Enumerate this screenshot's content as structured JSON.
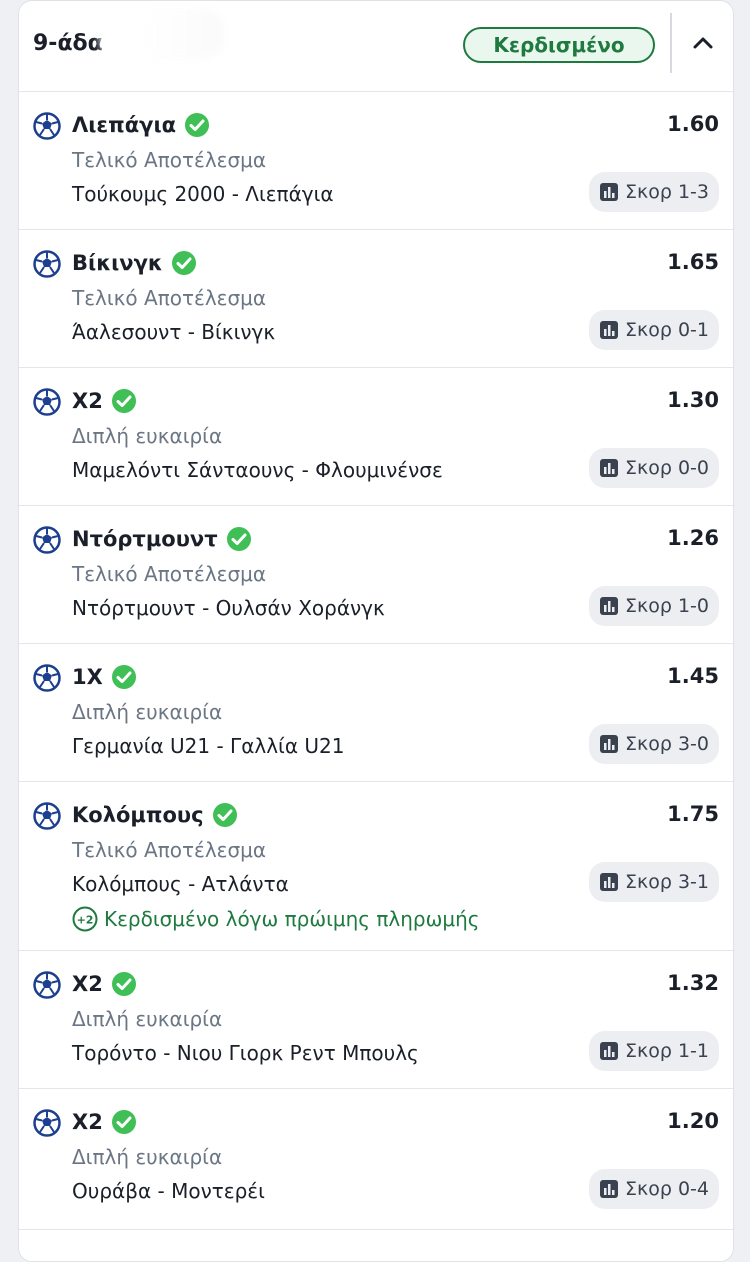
{
  "header": {
    "title": "9-άδα",
    "status": "Κερδισμένο"
  },
  "bets": [
    {
      "selection": "Λιεπάγια",
      "odds": "1.60",
      "market": "Τελικό Αποτέλεσμα",
      "match": "Τούκουμς 2000 - Λιεπάγια",
      "score": "Σκορ 1-3"
    },
    {
      "selection": "Βίκινγκ",
      "odds": "1.65",
      "market": "Τελικό Αποτέλεσμα",
      "match": "Άαλεσουντ - Βίκινγκ",
      "score": "Σκορ 0-1"
    },
    {
      "selection": "Χ2",
      "odds": "1.30",
      "market": "Διπλή ευκαιρία",
      "match": "Μαμελόντι Σάνταουνς - Φλουμινένσε",
      "score": "Σκορ 0-0"
    },
    {
      "selection": "Ντόρτμουντ",
      "odds": "1.26",
      "market": "Τελικό Αποτέλεσμα",
      "match": "Ντόρτμουντ - Ουλσάν Χοράνγκ",
      "score": "Σκορ 1-0"
    },
    {
      "selection": "1Χ",
      "odds": "1.45",
      "market": "Διπλή ευκαιρία",
      "match": "Γερμανία U21 - Γαλλία U21",
      "score": "Σκορ 3-0"
    },
    {
      "selection": "Κολόμπους",
      "odds": "1.75",
      "market": "Τελικό Αποτέλεσμα",
      "match": "Κολόμπους - Ατλάντα",
      "score": "Σκορ 3-1",
      "early_text": "Κερδισμένο λόγω πρώιμης πληρωμής",
      "early_badge": "+2"
    },
    {
      "selection": "Χ2",
      "odds": "1.32",
      "market": "Διπλή ευκαιρία",
      "match": "Τορόντο - Νιου Γιορκ Ρεντ Μπουλς",
      "score": "Σκορ 1-1"
    },
    {
      "selection": "Χ2",
      "odds": "1.20",
      "market": "Διπλή ευκαιρία",
      "match": "Ουράβα - Μοντερέι",
      "score": "Σκορ 0-4"
    }
  ],
  "colors": {
    "accent_green": "#1f7a3f",
    "check_green": "#3fbf55",
    "ball_blue": "#1d3f8f"
  }
}
